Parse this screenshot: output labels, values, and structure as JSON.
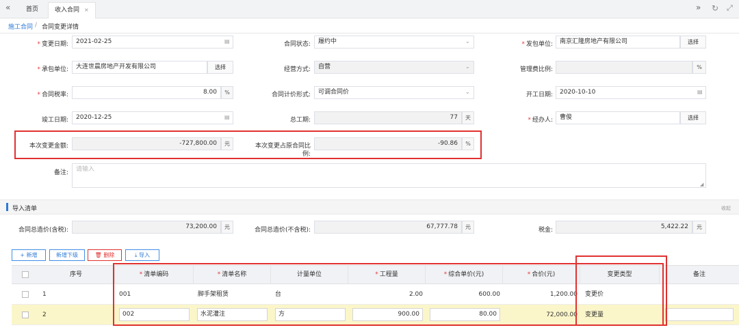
{
  "tabs": {
    "home": "首页",
    "contract": "收入合同",
    "close": "×"
  },
  "breadcrumb": {
    "parent": "施工合同",
    "sep": "/",
    "current": "合同变更详情"
  },
  "form": {
    "change_date_label": "变更日期:",
    "change_date": "2021-02-25",
    "status_label": "合同状态:",
    "status": "履约中",
    "issuer_label": "发包单位:",
    "issuer": "南京汇隆房地产有限公司",
    "contractor_label": "承包单位:",
    "contractor": "大连世晨房地产开发有限公司",
    "mgmt_label": "经营方式:",
    "mgmt": "自营",
    "fee_label": "管理费比例:",
    "fee": "",
    "tax_label": "合同税率:",
    "tax": "8.00",
    "pricing_label": "合同计价形式:",
    "pricing": "可调合同价",
    "start_label": "开工日期:",
    "start": "2020-10-10",
    "end_label": "竣工日期:",
    "end": "2020-12-25",
    "period_label": "总工期:",
    "period": "77",
    "handler_label": "经办人:",
    "handler": "曹俊",
    "change_amt_label": "本次变更金额:",
    "change_amt": "-727,800.00",
    "change_ratio_label1": "本次变更占原合同比",
    "change_ratio_label2": "例:",
    "change_ratio": "-90.86",
    "note_label": "备注:",
    "note_placeholder": "请输入",
    "select_btn": "选择",
    "unit_pct": "%",
    "unit_yuan": "元",
    "unit_day": "天"
  },
  "section": {
    "title": "导入清单",
    "collapse": "收起"
  },
  "totals": {
    "gross_label": "合同总造价(含税):",
    "gross": "73,200.00",
    "net_label": "合同总造价(不含税):",
    "net": "67,777.78",
    "taxamt_label": "税金:",
    "taxamt": "5,422.22"
  },
  "toolbar": {
    "add": "+ 新增",
    "add_sub": "新增下级",
    "delete": "删除",
    "import": "导入"
  },
  "table": {
    "headers": [
      "序号",
      "清单编码",
      "清单名称",
      "计量单位",
      "工程量",
      "综合单价(元)",
      "合价(元)",
      "变更类型",
      "备注"
    ],
    "rows": [
      {
        "idx": "1",
        "code": "001",
        "name": "脚手架租赁",
        "unit": "台",
        "qty": "2.00",
        "price": "600.00",
        "total": "1,200.00",
        "type": "变更价",
        "note": ""
      },
      {
        "idx": "2",
        "code": "002",
        "name": "水泥灌注",
        "unit": "方",
        "qty": "900.00",
        "price": "80.00",
        "total": "72,000.00",
        "type": "变更量",
        "note": ""
      }
    ]
  },
  "colors": {
    "accent": "#2d7ad6",
    "annotation": "#e0302f",
    "row_highlight": "#fbf6c9"
  }
}
